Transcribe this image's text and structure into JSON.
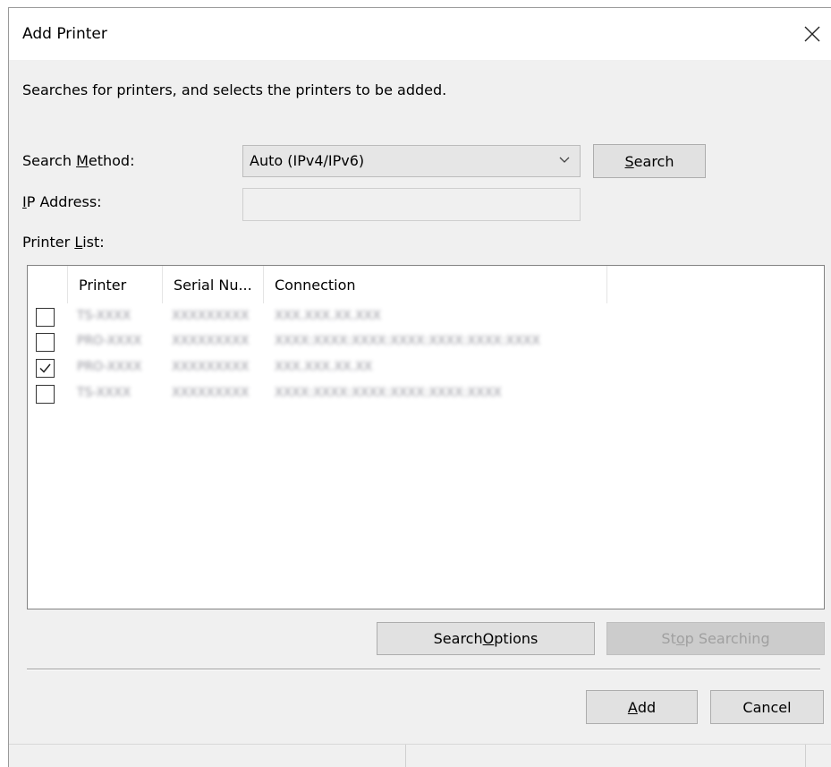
{
  "dialog": {
    "title": "Add Printer",
    "close_icon": "close-icon",
    "description": "Searches for printers, and selects the printers to be added."
  },
  "search_method": {
    "label_pre": "Search ",
    "label_accel": "M",
    "label_post": "ethod:",
    "value": "Auto (IPv4/IPv6)"
  },
  "search_button": {
    "accel": "S",
    "rest": "earch"
  },
  "ip_address": {
    "label_accel": "I",
    "label_rest": "P Address:",
    "value": ""
  },
  "printer_list": {
    "label_pre": "Printer ",
    "label_accel": "L",
    "label_post": "ist:",
    "columns": [
      "Printer",
      "Serial Nu...",
      "Connection"
    ],
    "rows": [
      {
        "checked": false,
        "printer": "TS-XXXX",
        "serial": "XXXXXXXXX",
        "connection": "XXX.XXX.XX.XXX"
      },
      {
        "checked": false,
        "printer": "PRO-XXXX",
        "serial": "XXXXXXXXX",
        "connection": "XXXX:XXXX:XXXX:XXXX:XXXX:XXXX:XXXX"
      },
      {
        "checked": true,
        "printer": "PRO-XXXX",
        "serial": "XXXXXXXXX",
        "connection": "XXX.XXX.XX.XX"
      },
      {
        "checked": false,
        "printer": "TS-XXXX",
        "serial": "XXXXXXXXX",
        "connection": "XXXX:XXXX:XXXX:XXXX:XXXX:XXXX"
      }
    ]
  },
  "search_options_button": {
    "pre": "Search ",
    "accel": "O",
    "post": "ptions"
  },
  "stop_searching_button": {
    "pre": "St",
    "accel": "o",
    "post": "p Searching"
  },
  "add_button": {
    "accel": "A",
    "rest": "dd"
  },
  "cancel_button": {
    "label": "Cancel"
  }
}
